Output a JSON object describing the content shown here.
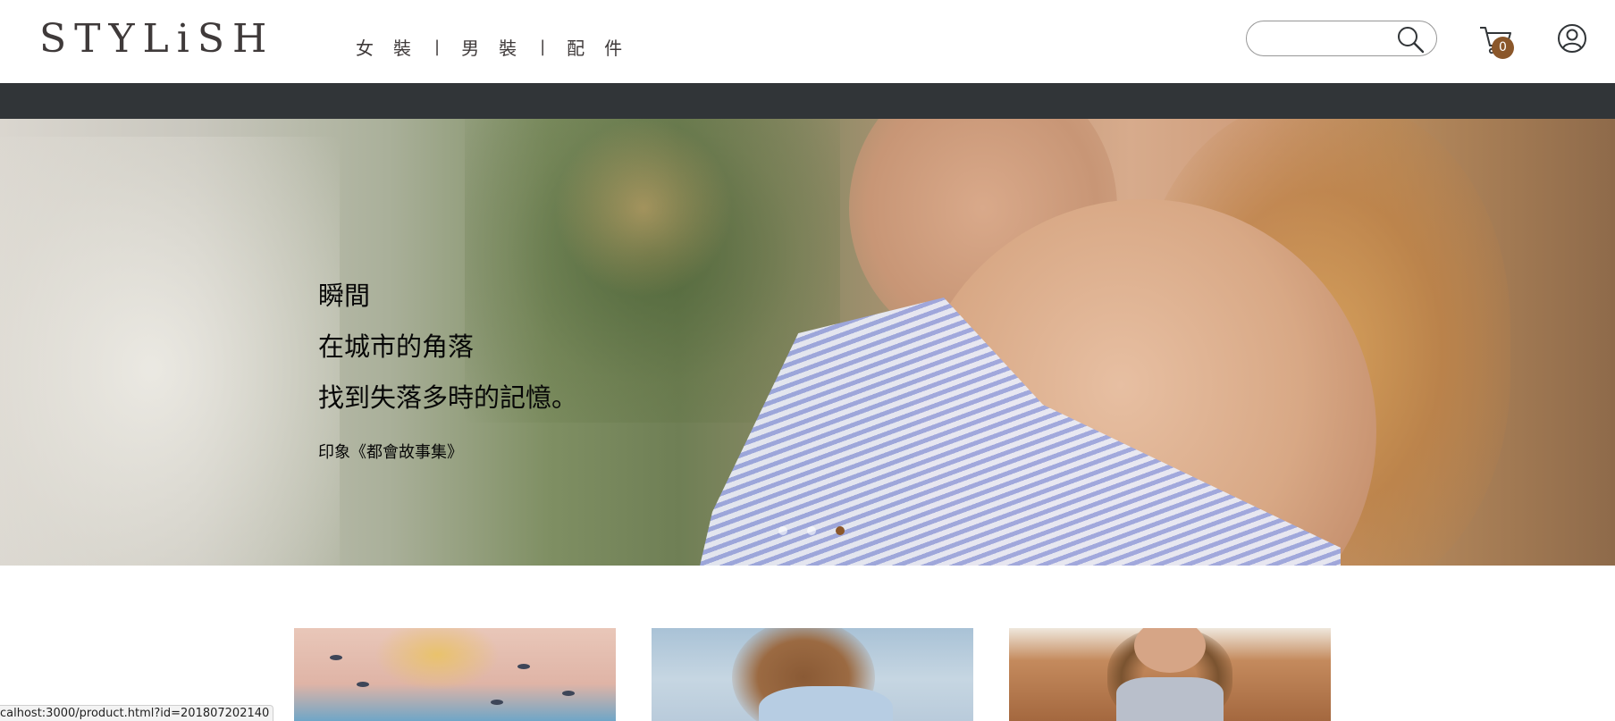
{
  "header": {
    "logo": "STYLiSH",
    "nav": [
      {
        "label": "女裝"
      },
      {
        "label": "男裝"
      },
      {
        "label": "配件"
      }
    ],
    "nav_separator": "|",
    "search": {
      "placeholder": "",
      "value": ""
    },
    "cart_count": "0"
  },
  "hero": {
    "lines": [
      "瞬間",
      "在城市的角落",
      "找到失落多時的記憶。"
    ],
    "source": "印象《都會故事集》",
    "dots": [
      {
        "active": false
      },
      {
        "active": false
      },
      {
        "active": true
      }
    ]
  },
  "products": [
    {
      "alt": "product-1"
    },
    {
      "alt": "product-2"
    },
    {
      "alt": "product-3"
    }
  ],
  "status_bar": {
    "url": "calhost:3000/product.html?id=201807202140"
  },
  "colors": {
    "dark_bar": "#313538",
    "brand_brown": "#8b572a",
    "text": "#3f3a3a"
  },
  "icons": {
    "search": "search-icon",
    "cart": "cart-icon",
    "member": "member-icon"
  }
}
